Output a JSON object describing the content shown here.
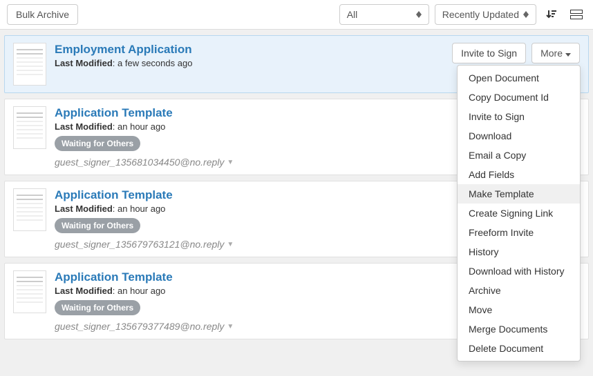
{
  "toolbar": {
    "bulk_archive": "Bulk Archive",
    "filter_label": "All",
    "sort_label": "Recently Updated"
  },
  "documents": [
    {
      "title": "Employment Application",
      "modified_label": "Last Modified",
      "modified_value": "a few seconds ago",
      "selected": true,
      "invite_label": "Invite to Sign",
      "more_label": "More"
    },
    {
      "title": "Application Template",
      "modified_label": "Last Modified",
      "modified_value": "an hour ago",
      "status": "Waiting for Others",
      "signer": "guest_signer_135681034450@no.reply"
    },
    {
      "title": "Application Template",
      "modified_label": "Last Modified",
      "modified_value": "an hour ago",
      "status": "Waiting for Others",
      "signer": "guest_signer_135679763121@no.reply"
    },
    {
      "title": "Application Template",
      "modified_label": "Last Modified",
      "modified_value": "an hour ago",
      "status": "Waiting for Others",
      "signer": "guest_signer_135679377489@no.reply"
    }
  ],
  "dropdown": {
    "items": [
      "Open Document",
      "Copy Document Id",
      "Invite to Sign",
      "Download",
      "Email a Copy",
      "Add Fields",
      "Make Template",
      "Create Signing Link",
      "Freeform Invite",
      "History",
      "Download with History",
      "Archive",
      "Move",
      "Merge Documents",
      "Delete Document"
    ],
    "hover_index": 6
  }
}
